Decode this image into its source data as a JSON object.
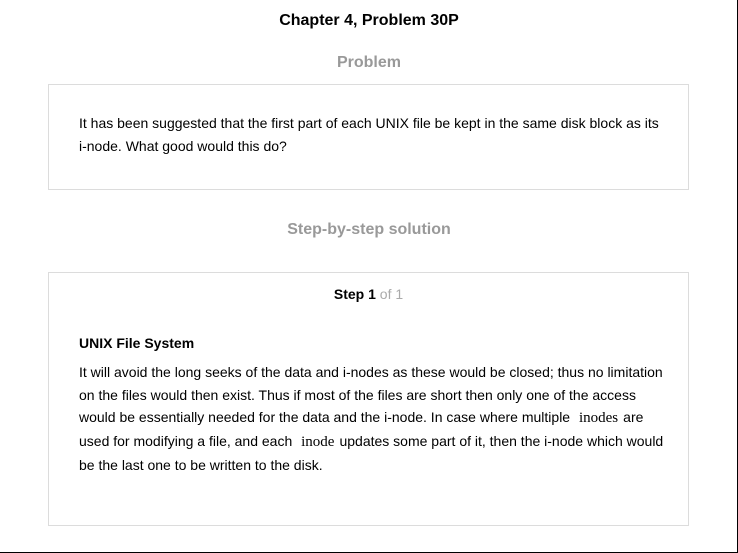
{
  "page": {
    "title": "Chapter 4, Problem 30P"
  },
  "problem": {
    "heading": "Problem",
    "text": "It has been suggested that the first part of each UNIX file be kept in the same disk block as its i-node. What good would this do?"
  },
  "solution": {
    "heading": "Step-by-step solution",
    "step": {
      "word": "Step",
      "number": "1",
      "of_text": "of 1",
      "title": "UNIX File System",
      "body_part1": "It will avoid the long seeks of the data and i-nodes as these would be closed; thus no limitation on the files would then exist. Thus if most of the files are short then only one of the access would be essentially needed for the data and the i-node. In case where multiple",
      "term1": "inodes",
      "body_part2": "are used for modifying a file, and each",
      "term2": "inode",
      "body_part3": "updates some part of it, then the i-node which would be the last one to be written to the disk."
    }
  }
}
